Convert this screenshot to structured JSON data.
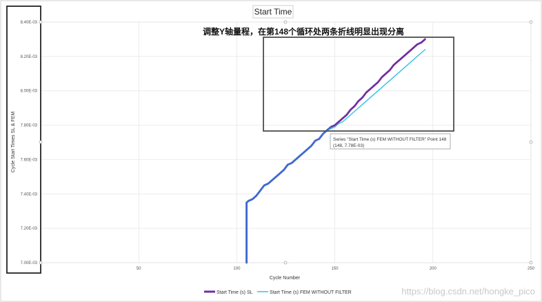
{
  "chart_data": {
    "type": "line",
    "title": "Start Time",
    "annotation": "调整Y轴量程，在第148个循环处两条折线明显出现分离",
    "xlabel": "Cycle Number",
    "ylabel": "Cycle Start Times SL & FEM",
    "xlim": [
      0,
      250
    ],
    "ylim": [
      0.007,
      0.0084
    ],
    "x_ticks": [
      "50",
      "100",
      "150",
      "200",
      "250"
    ],
    "x_tick_values": [
      50,
      100,
      150,
      200,
      250
    ],
    "y_ticks": [
      "7.00E-03",
      "7.20E-03",
      "7.40E-03",
      "7.60E-03",
      "7.80E-03",
      "8.00E-03",
      "8.20E-03",
      "8.40E-03"
    ],
    "y_tick_values": [
      0.007,
      0.0072,
      0.0074,
      0.0076,
      0.0078,
      0.008,
      0.0082,
      0.0084
    ],
    "grid": true,
    "legend_position": "bottom",
    "series": [
      {
        "name": "Start Time (s) SL",
        "color": "#7030a0",
        "points": [
          [
            105,
            0.007
          ],
          [
            105,
            0.00735
          ],
          [
            106,
            0.00736
          ],
          [
            108,
            0.00737
          ],
          [
            110,
            0.00739
          ],
          [
            112,
            0.00742
          ],
          [
            114,
            0.00745
          ],
          [
            116,
            0.00746
          ],
          [
            118,
            0.00748
          ],
          [
            120,
            0.0075
          ],
          [
            122,
            0.00752
          ],
          [
            124,
            0.00754
          ],
          [
            126,
            0.00757
          ],
          [
            128,
            0.00758
          ],
          [
            130,
            0.0076
          ],
          [
            132,
            0.00762
          ],
          [
            134,
            0.00764
          ],
          [
            136,
            0.00766
          ],
          [
            138,
            0.00768
          ],
          [
            140,
            0.00771
          ],
          [
            142,
            0.00772
          ],
          [
            144,
            0.00775
          ],
          [
            146,
            0.00777
          ],
          [
            148,
            0.00779
          ],
          [
            150,
            0.0078
          ],
          [
            152,
            0.00782
          ],
          [
            154,
            0.00784
          ],
          [
            156,
            0.00786
          ],
          [
            158,
            0.00789
          ],
          [
            160,
            0.00791
          ],
          [
            162,
            0.00794
          ],
          [
            164,
            0.00796
          ],
          [
            166,
            0.00799
          ],
          [
            168,
            0.00801
          ],
          [
            170,
            0.00803
          ],
          [
            172,
            0.00805
          ],
          [
            174,
            0.00808
          ],
          [
            176,
            0.0081
          ],
          [
            178,
            0.00812
          ],
          [
            180,
            0.00815
          ],
          [
            182,
            0.00817
          ],
          [
            184,
            0.00819
          ],
          [
            186,
            0.00821
          ],
          [
            188,
            0.00823
          ],
          [
            190,
            0.00825
          ],
          [
            192,
            0.00827
          ],
          [
            194,
            0.00828
          ],
          [
            196,
            0.0083
          ]
        ]
      },
      {
        "name": "Start Time (s) FEM WITHOUT FILTER",
        "color": "#33c1e8",
        "points": [
          [
            105,
            0.007
          ],
          [
            105,
            0.00735
          ],
          [
            106,
            0.00736
          ],
          [
            108,
            0.00737
          ],
          [
            110,
            0.00739
          ],
          [
            112,
            0.00742
          ],
          [
            114,
            0.00745
          ],
          [
            116,
            0.00746
          ],
          [
            118,
            0.00748
          ],
          [
            120,
            0.0075
          ],
          [
            122,
            0.00752
          ],
          [
            124,
            0.00754
          ],
          [
            126,
            0.00757
          ],
          [
            128,
            0.00758
          ],
          [
            130,
            0.0076
          ],
          [
            132,
            0.00762
          ],
          [
            134,
            0.00764
          ],
          [
            136,
            0.00766
          ],
          [
            138,
            0.00768
          ],
          [
            140,
            0.00771
          ],
          [
            142,
            0.00772
          ],
          [
            144,
            0.00775
          ],
          [
            146,
            0.00777
          ],
          [
            148,
            0.00778
          ],
          [
            150,
            0.00779
          ],
          [
            152,
            0.00781
          ],
          [
            154,
            0.00782
          ],
          [
            156,
            0.00784
          ],
          [
            158,
            0.00786
          ],
          [
            160,
            0.00788
          ],
          [
            162,
            0.0079
          ],
          [
            164,
            0.00792
          ],
          [
            166,
            0.00794
          ],
          [
            168,
            0.00796
          ],
          [
            170,
            0.00798
          ],
          [
            172,
            0.008
          ],
          [
            174,
            0.00802
          ],
          [
            176,
            0.00804
          ],
          [
            178,
            0.00806
          ],
          [
            180,
            0.00808
          ],
          [
            182,
            0.0081
          ],
          [
            184,
            0.00812
          ],
          [
            186,
            0.00814
          ],
          [
            188,
            0.00816
          ],
          [
            190,
            0.00818
          ],
          [
            192,
            0.0082
          ],
          [
            194,
            0.00822
          ],
          [
            196,
            0.00824
          ]
        ]
      }
    ],
    "tooltip": {
      "line1": "Series \"Start Time (s) FEM WITHOUT FILTER\" Point 148",
      "line2": "(148, 7.78E-03)"
    }
  },
  "watermark": "https://blog.csdn.net/hongke_pico"
}
